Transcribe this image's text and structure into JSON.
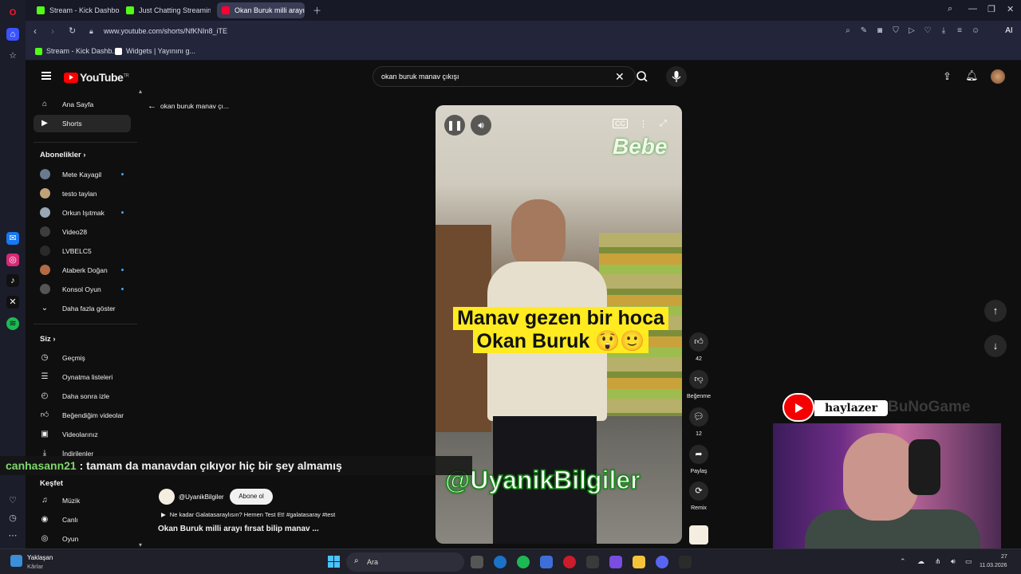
{
  "browser": {
    "tabs": [
      {
        "label": "Stream - Kick Dashboard",
        "color": "#53fc18"
      },
      {
        "label": "Just Chatting Streaming -",
        "color": "#53fc18"
      },
      {
        "label": "Okan Buruk milli arayı",
        "color": "#ff0033"
      }
    ],
    "url": "www.youtube.com/shorts/NfKNIn8_iTE",
    "bookmarks": [
      "Stream - Kick Dashb...",
      "Widgets | Yayınını g..."
    ],
    "ai_label": "AI"
  },
  "youtube": {
    "logo": "YouTube",
    "region": "TR",
    "search_query": "okan buruk manav çıkışı",
    "back_query": "okan buruk manav çı...",
    "nav": [
      {
        "label": "Ana Sayfa",
        "icon": "home-icon"
      },
      {
        "label": "Shorts",
        "icon": "shorts-icon"
      }
    ],
    "subscriptions_header": "Abonelikler",
    "subscriptions": [
      {
        "label": "Mete Kayagil",
        "dot": true,
        "color": "#6a7b8f"
      },
      {
        "label": "testo taylan",
        "dot": false,
        "color": "#c0a37a"
      },
      {
        "label": "Orkun Işıtmak",
        "dot": true,
        "color": "#9aa7b5"
      },
      {
        "label": "Video28",
        "dot": false,
        "color": "#3d3d3d"
      },
      {
        "label": "LVBELC5",
        "dot": false,
        "color": "#2a2a2a"
      },
      {
        "label": "Ataberk Doğan",
        "dot": true,
        "color": "#b36a45"
      },
      {
        "label": "Konsol Oyun",
        "dot": true,
        "color": "#555555"
      }
    ],
    "show_more": "Daha fazla göster",
    "you_header": "Siz",
    "you_items": [
      {
        "label": "Geçmiş",
        "icon": "history-icon"
      },
      {
        "label": "Oynatma listeleri",
        "icon": "playlist-icon"
      },
      {
        "label": "Daha sonra izle",
        "icon": "clock-icon"
      },
      {
        "label": "Beğendiğim videolar",
        "icon": "like-icon"
      },
      {
        "label": "Videolarınız",
        "icon": "video-icon"
      },
      {
        "label": "İndirilenler",
        "icon": "download-icon"
      }
    ],
    "explore_header": "Keşfet",
    "explore_items": [
      {
        "label": "Müzik",
        "icon": "music-icon"
      },
      {
        "label": "Canlı",
        "icon": "live-icon"
      },
      {
        "label": "Oyun",
        "icon": "game-icon"
      }
    ]
  },
  "short": {
    "caption_line1": "Manav gezen bir hoca",
    "caption_line2": "Okan Buruk 😲🙂",
    "brand_text": "Bebe",
    "watermark": "@UyanikBilgiler",
    "likes": "42",
    "dislike_label": "Beğenme",
    "comments": "12",
    "share_label": "Paylaş",
    "remix_label": "Remix",
    "channel": "@UyanikBilgiler",
    "subscribe_label": "Abone ol",
    "music": "Ne kadar Galatasaraylısın? Hemen Test Et! #galatasaray #test",
    "title": "Okan Buruk milli arayı fırsat bilip manav ..."
  },
  "overlay": {
    "chat_user": "canhasann21",
    "chat_message": ": tamam da manavdan çıkıyor hiç bir şey almamış",
    "streamer_tag": "haylazer",
    "tag_extra": "BuNoGame"
  },
  "taskbar": {
    "weather_title": "Yaklaşan",
    "weather_sub": "Kârlar",
    "search_label": "Ara",
    "time": "27",
    "date": "11.03.2026"
  }
}
